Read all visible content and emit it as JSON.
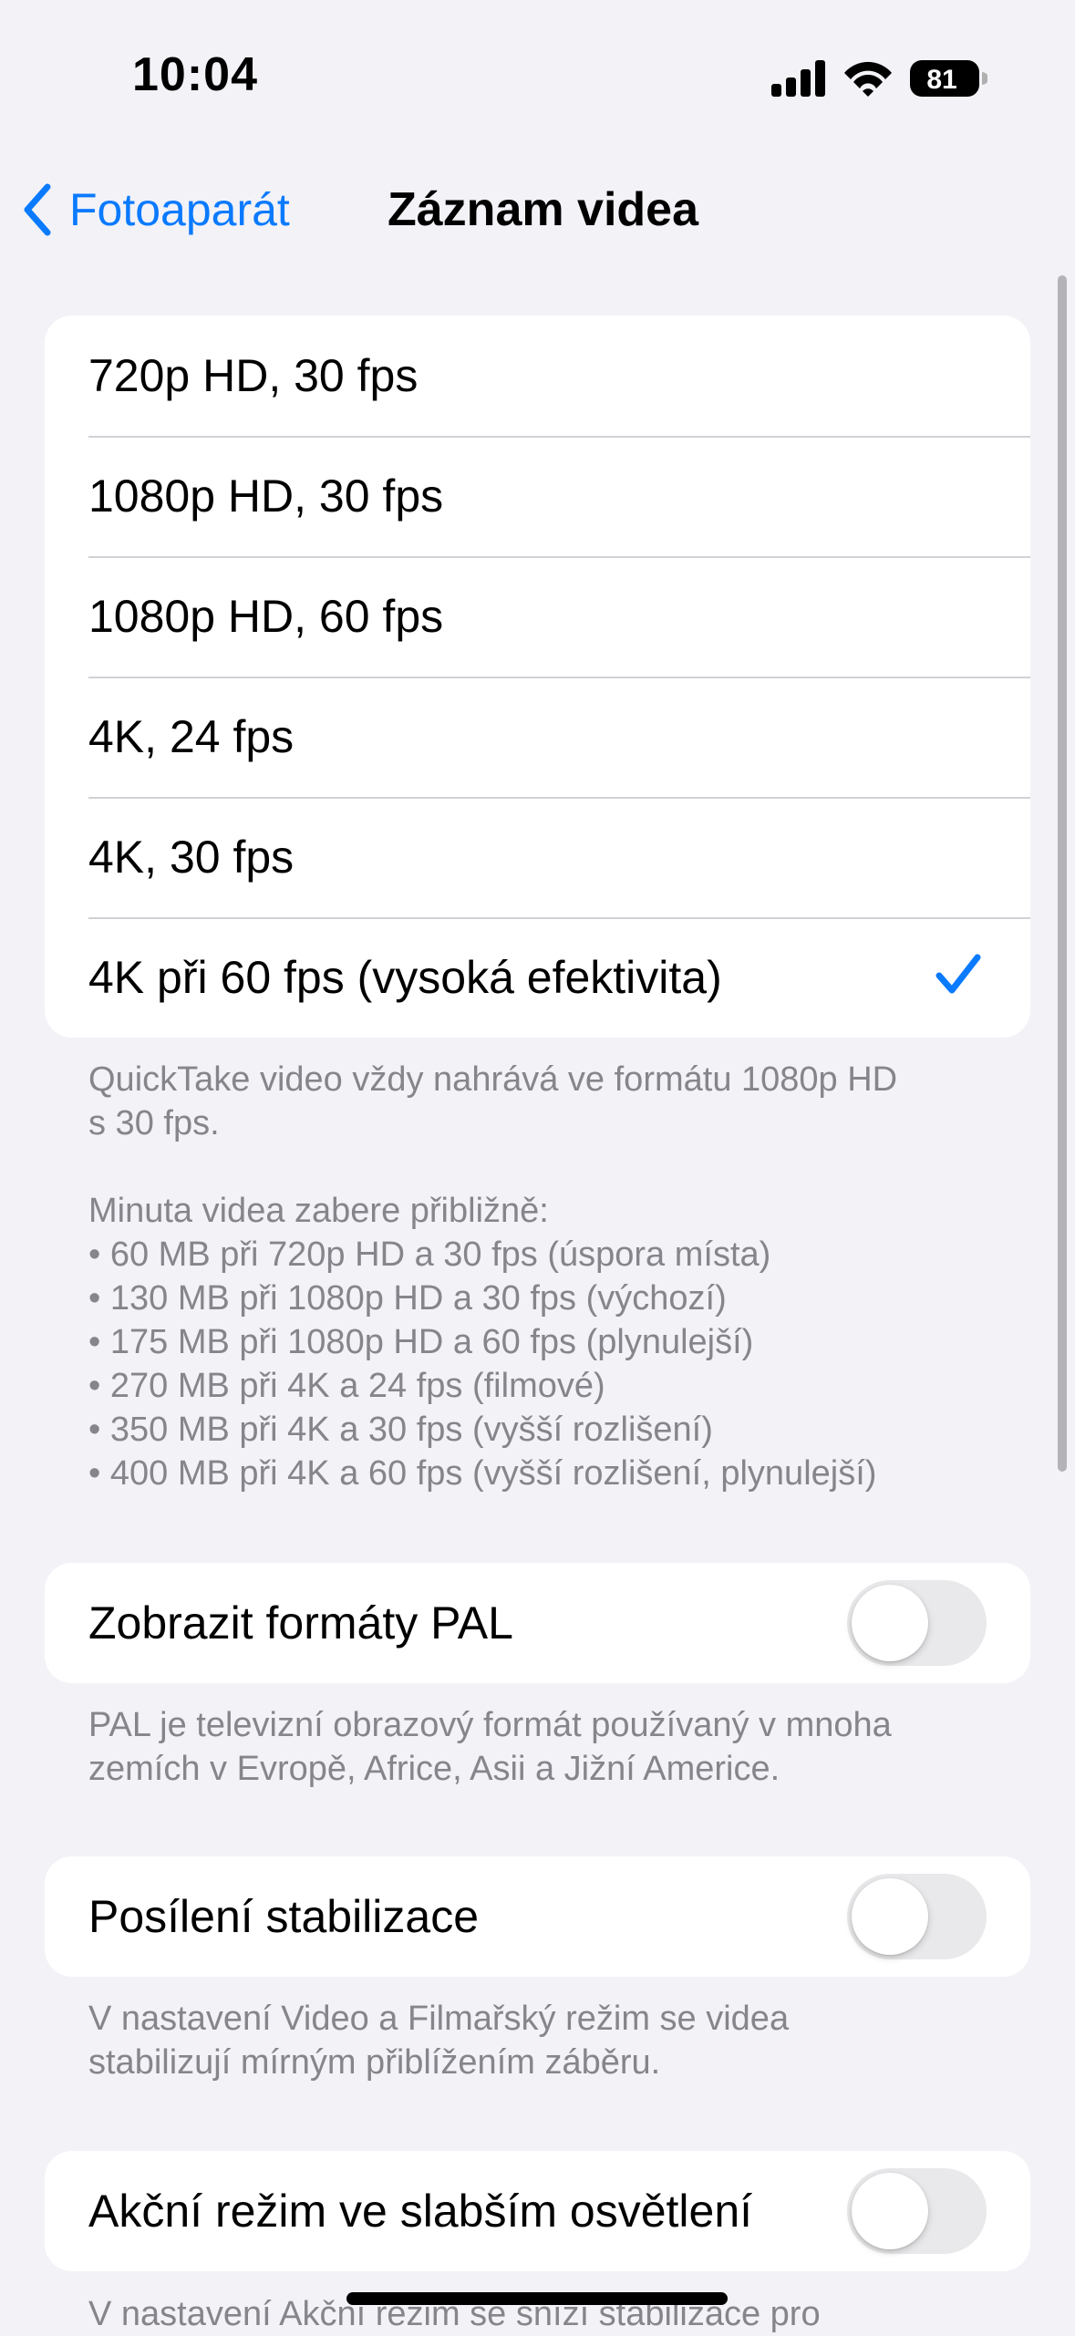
{
  "status_bar": {
    "time": "10:04",
    "battery_level": "81",
    "icons": [
      "cellular-signal-icon",
      "wifi-icon",
      "battery-icon"
    ]
  },
  "nav": {
    "back_label": "Fotoaparát",
    "title": "Záznam videa"
  },
  "formats": {
    "options": [
      "720p HD, 30 fps",
      "1080p HD, 30 fps",
      "1080p HD, 60 fps",
      "4K, 24 fps",
      "4K, 30 fps",
      "4K při 60 fps (vysoká efektivita)"
    ],
    "selected_index": 5,
    "footer_quicktake_1": "QuickTake video vždy nahrává ve formátu 1080p HD",
    "footer_quicktake_2": "s 30 fps.",
    "footer_size_heading": "Minuta videa zabere přibližně:",
    "footer_sizes": [
      "• 60 MB při 720p HD a 30 fps (úspora místa)",
      "• 130 MB při 1080p HD a 30 fps (výchozí)",
      "• 175 MB při 1080p HD a 60 fps (plynulejší)",
      "• 270 MB při 4K a 24 fps (filmové)",
      "• 350 MB při 4K a 30 fps (vyšší rozlišení)",
      "• 400 MB při 4K a 60 fps (vyšší rozlišení, plynulejší)"
    ]
  },
  "pal": {
    "label": "Zobrazit formáty PAL",
    "enabled": false,
    "footer_1": "PAL je televizní obrazový formát používaný v mnoha",
    "footer_2": "zemích v Evropě, Africe, Asii a Jižní Americe."
  },
  "stabilization": {
    "label": "Posílení stabilizace",
    "enabled": false,
    "footer_1": "V nastavení Video a Filmařský režim se videa",
    "footer_2": "stabilizují mírným přiblížením záběru."
  },
  "action_mode": {
    "label": "Akční režim ve slabším osvětlení",
    "enabled": false,
    "footer_1": "V nastavení Akční režim se sníží stabilizace pro"
  },
  "colors": {
    "accent": "#0a7aff",
    "background": "#f2f2f7",
    "toggle_off": "#e9e9eb",
    "footer_text": "#85858b"
  }
}
